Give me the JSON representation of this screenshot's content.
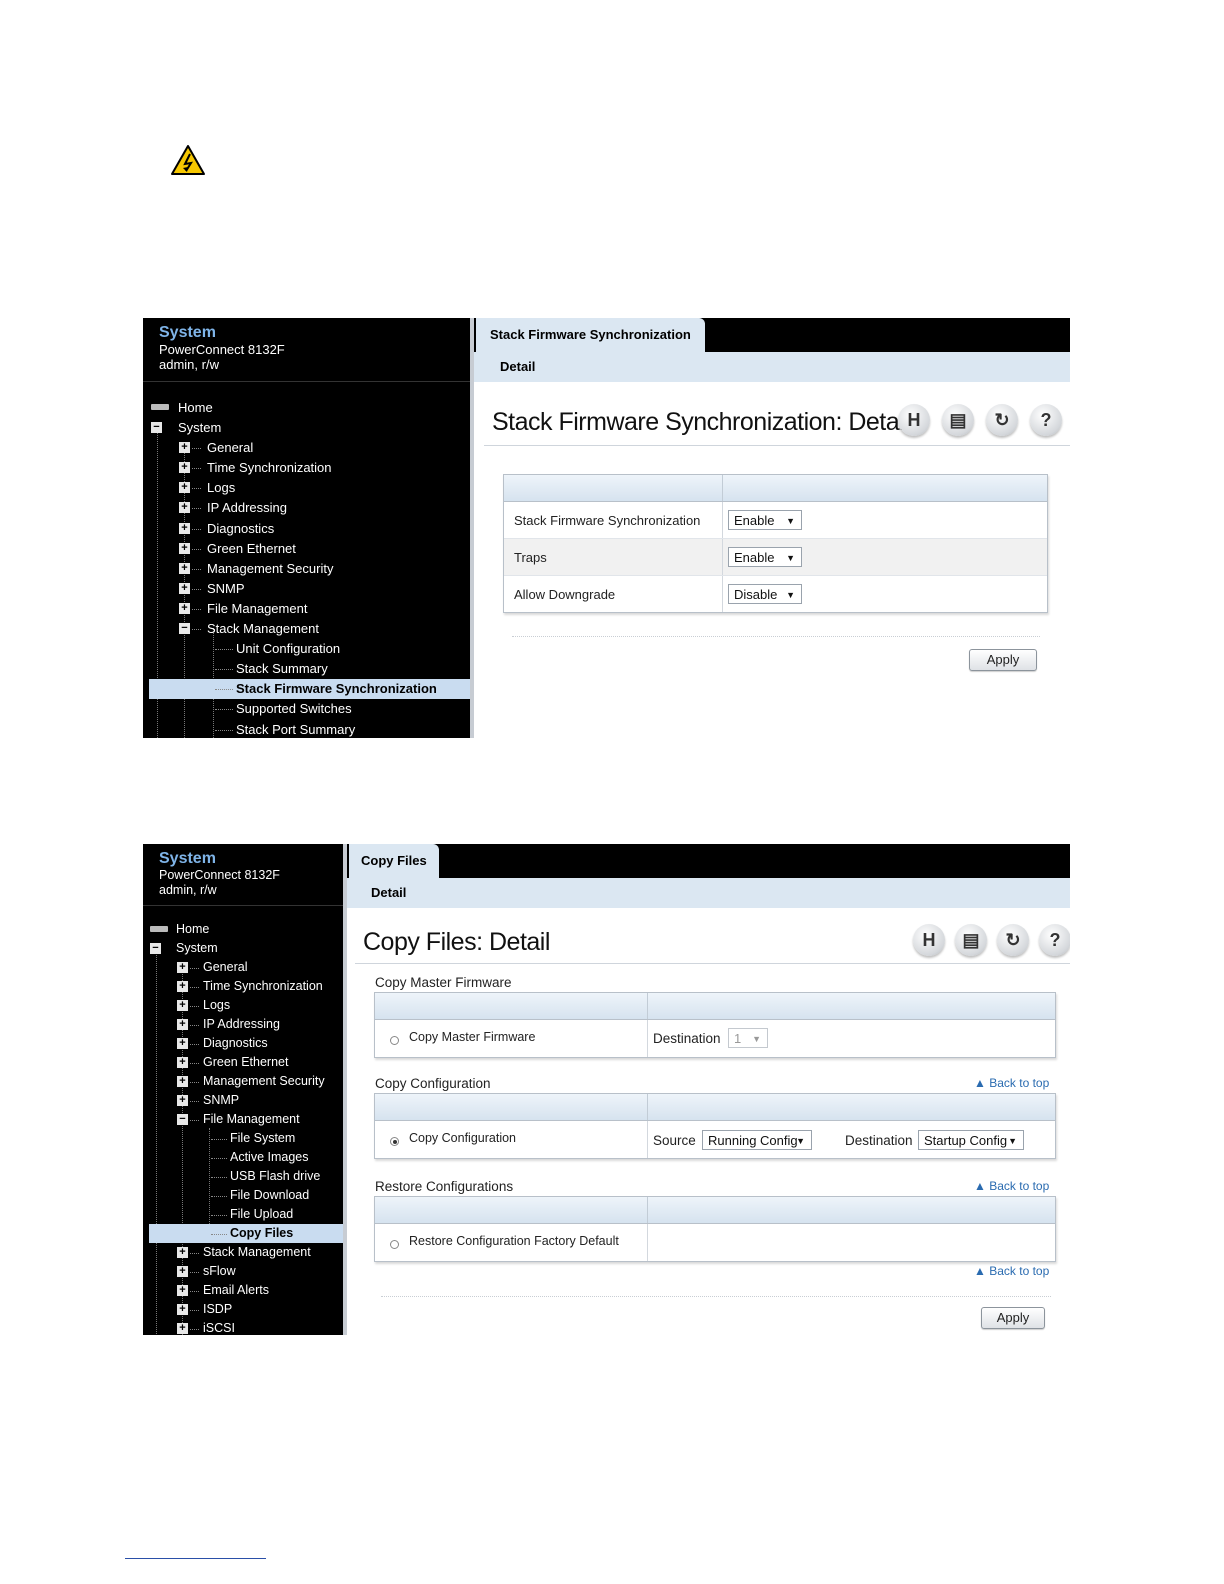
{
  "nav": {
    "title": "System",
    "model": "PowerConnect 8132F",
    "user": "admin, r/w"
  },
  "screen1": {
    "tree": [
      "Home",
      "System",
      "General",
      "Time Synchronization",
      "Logs",
      "IP Addressing",
      "Diagnostics",
      "Green Ethernet",
      "Management Security",
      "SNMP",
      "File Management",
      "Stack Management",
      "Unit Configuration",
      "Stack Summary",
      "Stack Firmware Synchronization",
      "Supported Switches",
      "Stack Port Summary"
    ],
    "tab": "Stack Firmware Synchronization",
    "subtab": "Detail",
    "page_title": "Stack Firmware Synchronization: Detail",
    "rows": [
      {
        "label": "Stack Firmware Synchronization",
        "value": "Enable"
      },
      {
        "label": "Traps",
        "value": "Enable"
      },
      {
        "label": "Allow Downgrade",
        "value": "Disable"
      }
    ],
    "apply": "Apply"
  },
  "screen2": {
    "tree": [
      "Home",
      "System",
      "General",
      "Time Synchronization",
      "Logs",
      "IP Addressing",
      "Diagnostics",
      "Green Ethernet",
      "Management Security",
      "SNMP",
      "File Management",
      "File System",
      "Active Images",
      "USB Flash drive",
      "File Download",
      "File Upload",
      "Copy Files",
      "Stack Management",
      "sFlow",
      "Email Alerts",
      "ISDP",
      "iSCSI"
    ],
    "tab": "Copy Files",
    "subtab": "Detail",
    "page_title": "Copy Files: Detail",
    "sections": {
      "master": {
        "title": "Copy Master Firmware",
        "option": "Copy Master Firmware",
        "dest_label": "Destination",
        "dest_value": "1"
      },
      "config": {
        "title": "Copy Configuration",
        "option": "Copy Configuration",
        "source_label": "Source",
        "source_value": "Running Config",
        "dest_label": "Destination",
        "dest_value": "Startup Config"
      },
      "restore": {
        "title": "Restore Configurations",
        "option": "Restore Configuration Factory Default"
      }
    },
    "back_to_top": "Back to top",
    "apply": "Apply"
  },
  "icons": [
    "warning-icon",
    "save-icon",
    "print-icon",
    "refresh-icon",
    "help-icon"
  ],
  "colors": {
    "nav_bg": "#000000",
    "nav_title": "#7fb4e8",
    "header_tint": "#dbe7f2",
    "link": "#2a6bb0"
  }
}
